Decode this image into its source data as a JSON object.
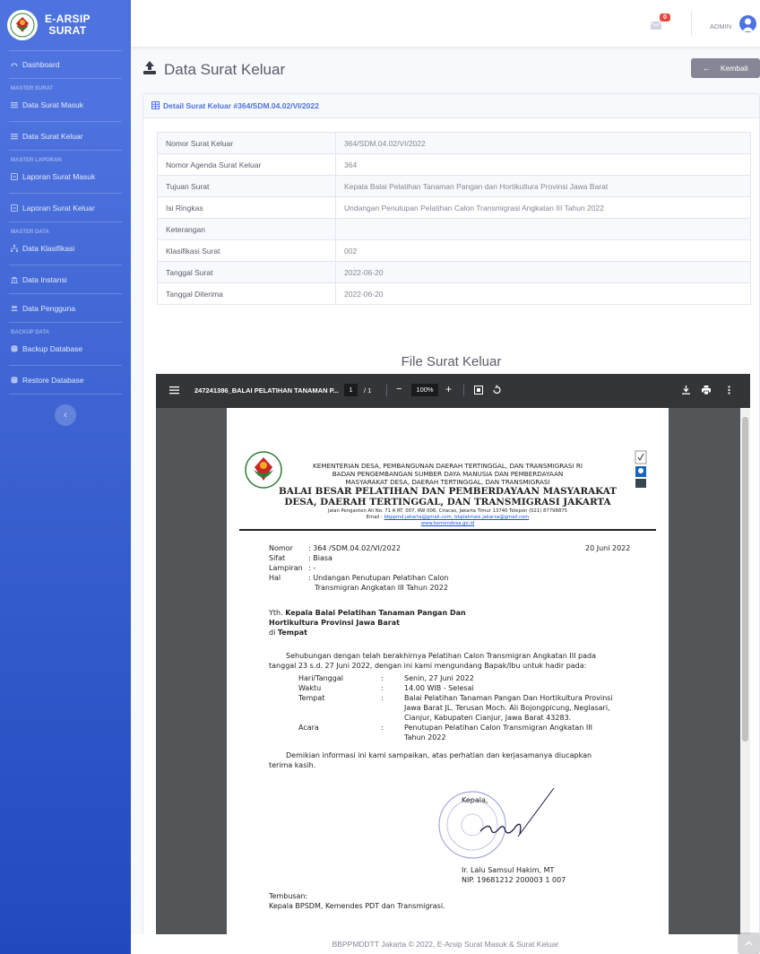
{
  "sidebar": {
    "brand": "E-ARSIP\nSURAT",
    "dashboard": "Dashboard",
    "heading_surat": "MASTER SURAT",
    "data_surat_masuk": "Data Surat Masuk",
    "data_surat_keluar": "Data Surat Keluar",
    "heading_laporan": "MASTER LAPORAN",
    "laporan_surat_masuk": "Laporan Surat Masuk",
    "laporan_surat_keluar": "Laporan Surat Keluar",
    "heading_data": "MASTER DATA",
    "data_klasifikasi": "Data Klasifikasi",
    "data_instansi": "Data Instansi",
    "data_pengguna": "Data Pengguna",
    "heading_backup": "BACKUP DATA",
    "backup_database": "Backup Database",
    "restore_database": "Restore Database",
    "toggle": "‹"
  },
  "topbar": {
    "badge": "0",
    "user": "ADMIN"
  },
  "page": {
    "title": "Data Surat Keluar",
    "back_label": "Kembali",
    "back_icon": "←"
  },
  "card": {
    "header": "Detail Surat Keluar #364/SDM.04.02/VI/2022",
    "rows": [
      {
        "label": "Nomor Surat Keluar",
        "value": "364/SDM.04.02/VI/2022"
      },
      {
        "label": "Nomor Agenda Surat Keluar",
        "value": "364"
      },
      {
        "label": "Tujuan Surat",
        "value": "Kepala Balai Pelatihan Tanaman Pangan dan Hortikultura Provinsi Jawa Barat"
      },
      {
        "label": "Isi Ringkas",
        "value": "Undangan Penutupan Pelatihan Calon Transmigrasi Angkatan III Tahun 2022"
      },
      {
        "label": "Keterangan",
        "value": ""
      },
      {
        "label": "Klasifikasi Surat",
        "value": "002"
      },
      {
        "label": "Tanggal Surat",
        "value": "2022-06-20"
      },
      {
        "label": "Tanggal Diterima",
        "value": "2022-06-20"
      }
    ],
    "file_title": "File Surat Keluar"
  },
  "pdf_viewer": {
    "filename": "247241386_BALAI PELATIHAN TANAMAN P...",
    "page_current": "1",
    "page_sep": "/ 1",
    "zoom": "100%"
  },
  "letter": {
    "ministry": "KEMENTERIAN DESA, PEMBANGUNAN DAERAH TERTINGGAL, DAN TRANSMIGRASI RI",
    "agency1": "BADAN PENGEMBANGAN SUMBER DAYA MANUSIA DAN PEMBERDAYAAN",
    "agency2": "MASYARAKAT DESA, DAERAH TERTINGGAL, DAN TRANSMIGRASI",
    "balai1": "BALAI BESAR PELATIHAN DAN PEMBERDAYAAN MASYARAKAT",
    "balai2": "DESA, DAERAH TERTINGGAL, DAN TRANSMIGRASI JAKARTA",
    "address": "Jalan Penganten Ali No. 71 A RT. 007, RW 006, Ciracas, Jakarta Timur 13740 Telepon (021) 87798875",
    "email_label": "Email :",
    "email": "bbppmd.jakarta@gmail.com, bbplatmasi.jakarsa@gmail.com",
    "web": "www.kemendesa.go.id",
    "nomor_label": "Nomor",
    "nomor": ": 364 /SDM.04.02/VI/2022",
    "date": "20 Juni 2022",
    "sifat_label": "Sifat",
    "sifat": ": Biasa",
    "lampiran_label": "Lampiran",
    "lampiran": ": -",
    "hal_label": "Hal",
    "hal1": ": Undangan Penutupan Pelatihan Calon",
    "hal2": "Transmigran Angkatan III Tahun 2022",
    "yth_prefix": "Yth. ",
    "yth_bold": "Kepala Balai Pelatihan Tanaman Pangan Dan",
    "yth_line2": "Hortikultura Provinsi Jawa Barat",
    "di_prefix": "di ",
    "di_bold": "Tempat",
    "para1a": "Sehubungan dengan telah berakhirnya Pelatihan Calon Transmigran Angkatan III pada",
    "para1b": "tanggal 23 s.d. 27 Juni 2022, dengan ini kami mengundang Bapak/Ibu untuk hadir pada:",
    "hari_label": "Hari/Tanggal",
    "hari": "Senin, 27 Juni 2022",
    "waktu_label": "Waktu",
    "waktu": "14.00 WIB - Selesai",
    "tempat_label": "Tempat",
    "tempat1": "Balai Pelatihan Tanaman Pangan Dan Hortikultura Provinsi",
    "tempat2": "Jawa Barat JL. Terusan Moch. Ali Bojongpicung, Neglasari,",
    "tempat3": "Cianjur, Kabupaten Cianjur, Jawa Barat 43283.",
    "acara_label": "Acara",
    "acara1": "Penutupan Pelatihan Calon Transmigran Angkatan III",
    "acara2": "Tahun 2022",
    "colon": ":",
    "closing1": "Demikian informasi ini kami sampaikan, atas perhatian dan kerjasamanya diucapkan",
    "closing2": "terima kasih.",
    "kepala": "Kepala,",
    "signer": "Ir. Lalu Samsul Hakim, MT",
    "nip": "NIP. 19681212 200003 1 007",
    "tembusan": "Tembusan:",
    "tembusan_to": "Kepala BPSDM, Kemendes PDT dan Transmigrasi."
  },
  "footer": "BBPPMDDTT Jakarta © 2022, E-Arsip Surat Masuk & Surat Keluar",
  "colors": {
    "primary": "#4e73df",
    "secondary": "#858796",
    "danger": "#e74a3b"
  }
}
